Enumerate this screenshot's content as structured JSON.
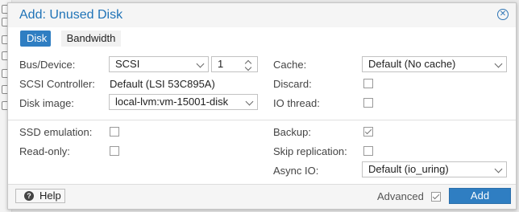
{
  "dialog": {
    "title": "Add: Unused Disk",
    "close_symbol": "✕"
  },
  "tabs": {
    "disk": "Disk",
    "bandwidth": "Bandwidth"
  },
  "left": {
    "bus_device_label": "Bus/Device:",
    "bus_value": "SCSI",
    "device_number": "1",
    "scsi_controller_label": "SCSI Controller:",
    "scsi_controller_value": "Default (LSI 53C895A)",
    "disk_image_label": "Disk image:",
    "disk_image_value": "local-lvm:vm-15001-disk",
    "ssd_emulation_label": "SSD emulation:",
    "read_only_label": "Read-only:"
  },
  "right": {
    "cache_label": "Cache:",
    "cache_value": "Default (No cache)",
    "discard_label": "Discard:",
    "io_thread_label": "IO thread:",
    "backup_label": "Backup:",
    "skip_replication_label": "Skip replication:",
    "async_io_label": "Async IO:",
    "async_io_value": "Default (io_uring)"
  },
  "checkboxes": {
    "discard": false,
    "io_thread": false,
    "ssd_emulation": false,
    "read_only": false,
    "backup": true,
    "skip_replication": false,
    "advanced": true
  },
  "footer": {
    "help_label": "Help",
    "help_icon_glyph": "?",
    "advanced_label": "Advanced",
    "add_label": "Add"
  },
  "colors": {
    "accent": "#2f7ec2",
    "title": "#1f73b7"
  }
}
